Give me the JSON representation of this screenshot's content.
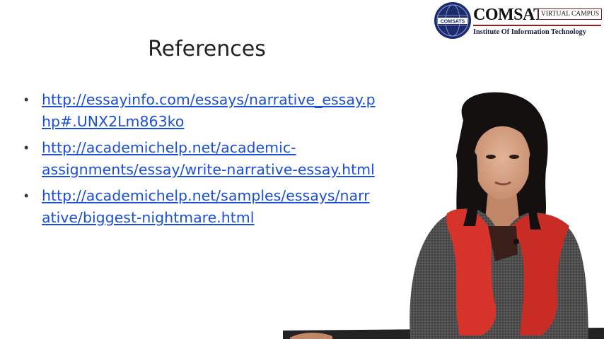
{
  "slide": {
    "title": "References",
    "references": [
      {
        "line1": "http://essayinfo.com/essays/narrative_essay.p",
        "line2": "hp#.UNX2Lm863ko"
      },
      {
        "line1": "http://academichelp.net/academic-",
        "line2": "assignments/essay/write-narrative-essay.html"
      },
      {
        "line1": "http://academichelp.net/samples/essays/narr",
        "line2": "ative/biggest-nightmare.html"
      }
    ],
    "bullet_glyph": "•",
    "link_color": "#1b4fd6"
  },
  "logo": {
    "name": "COMSATS",
    "emblem_text": "COMSATS",
    "campus": "VIRTUAL CAMPUS",
    "subtitle": "Institute Of Information Technology",
    "emblem_color": "#1e2a6e",
    "accent_color": "#9b1b1b"
  },
  "presenter": {
    "scarf_color": "#d6332a",
    "sweater_color": "#4a4a4a"
  }
}
